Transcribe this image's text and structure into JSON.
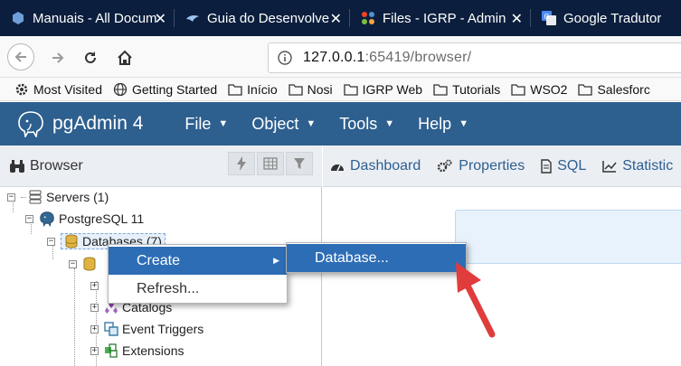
{
  "tabs": [
    {
      "title": "Manuais - All Docum",
      "icon": "hexagon-app-icon"
    },
    {
      "title": "Guia do Desenvolve",
      "icon": "bird-app-icon"
    },
    {
      "title": "Files - IGRP - Admin",
      "icon": "joomla-icon"
    },
    {
      "title": "Google Tradutor",
      "icon": "google-translate-icon"
    }
  ],
  "nav": {
    "url_host": "127.0.0.1",
    "url_rest": ":65419/browser/"
  },
  "bookmarks": [
    {
      "label": "Most Visited",
      "icon": "gear-icon"
    },
    {
      "label": "Getting Started",
      "icon": "globe-icon"
    },
    {
      "label": "Início",
      "icon": "folder-icon"
    },
    {
      "label": "Nosi",
      "icon": "folder-icon"
    },
    {
      "label": "IGRP Web",
      "icon": "folder-icon"
    },
    {
      "label": "Tutorials",
      "icon": "folder-icon"
    },
    {
      "label": "WSO2",
      "icon": "folder-icon"
    },
    {
      "label": "Salesforc",
      "icon": "folder-icon"
    }
  ],
  "app": {
    "name": "pgAdmin 4",
    "menu": [
      "File",
      "Object",
      "Tools",
      "Help"
    ]
  },
  "browser": {
    "title": "Browser",
    "tree": [
      {
        "label": "Servers (1)",
        "icon": "servers-icon"
      },
      {
        "label": "PostgreSQL 11",
        "icon": "postgres-elephant-icon"
      },
      {
        "label": "Databases (7)",
        "icon": "databases-icon"
      },
      {
        "label": "Catalogs",
        "icon": "catalogs-icon"
      },
      {
        "label": "Event Triggers",
        "icon": "event-triggers-icon"
      },
      {
        "label": "Extensions",
        "icon": "extensions-icon"
      }
    ]
  },
  "right_tabs": [
    {
      "label": "Dashboard",
      "icon": "dashboard-icon"
    },
    {
      "label": "Properties",
      "icon": "gears-icon"
    },
    {
      "label": "SQL",
      "icon": "file-icon"
    },
    {
      "label": "Statistic",
      "icon": "line-chart-icon"
    }
  ],
  "context_menu": {
    "items": [
      "Create",
      "Refresh..."
    ],
    "submenu_items": [
      "Database..."
    ]
  },
  "colors": {
    "tab_strip": "#0b1e3d",
    "pgadmin_header": "#2d5f8f",
    "menu_highlight": "#2d6db5",
    "annotation_arrow": "#e03c3c"
  }
}
